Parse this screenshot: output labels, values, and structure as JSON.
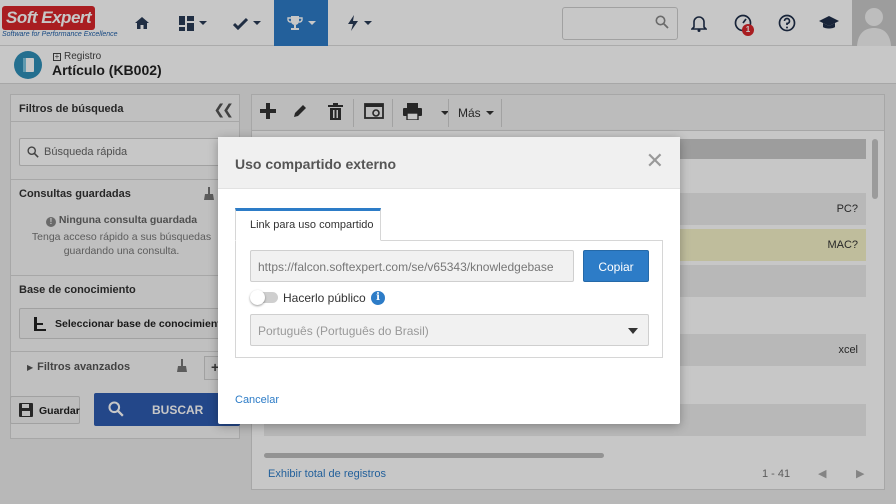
{
  "brand": {
    "name": "Soft Expert",
    "tagline": "Software for Performance Excellence"
  },
  "nav": {
    "items": [
      {
        "icon": "home-icon"
      },
      {
        "icon": "dashboard-icon"
      },
      {
        "icon": "check-icon"
      },
      {
        "icon": "trophy-icon",
        "active": true
      },
      {
        "icon": "lightning-icon"
      }
    ],
    "accent": "#2d7cc7"
  },
  "notifications": {
    "badge": "1"
  },
  "record": {
    "crumb": "Registro",
    "title": "Artículo (KB002)"
  },
  "filters": {
    "title": "Filtros de búsqueda",
    "quick_search_placeholder": "Búsqueda rápida",
    "saved_queries_title": "Consultas guardadas",
    "no_saved_title": "Ninguna consulta guardada",
    "no_saved_hint": "Tenga acceso rápido a sus búsquedas guardando una consulta.",
    "kb_title": "Base de conocimiento",
    "kb_button": "Seleccionar base de conocimiento",
    "advanced": "Filtros avanzados",
    "save_button": "Guardar",
    "search_button": "BUSCAR"
  },
  "grid": {
    "more_label": "Más",
    "rows": [
      {
        "text": "PC?",
        "style": "gray"
      },
      {
        "text": "MAC?",
        "style": "yel"
      },
      {
        "text": "",
        "style": "gray"
      },
      {
        "text": "xcel",
        "style": "gray"
      }
    ],
    "footer_link": "Exhibir total de registros",
    "pager": "1 - 41"
  },
  "modal": {
    "title": "Uso compartido externo",
    "tab": "Link para uso compartido",
    "link_value": "https://falcon.softexpert.com/se/v65343/knowledgebase",
    "copy_button": "Copiar",
    "public_label": "Hacerlo público",
    "language_value": "Português (Português do Brasil)",
    "cancel": "Cancelar"
  }
}
